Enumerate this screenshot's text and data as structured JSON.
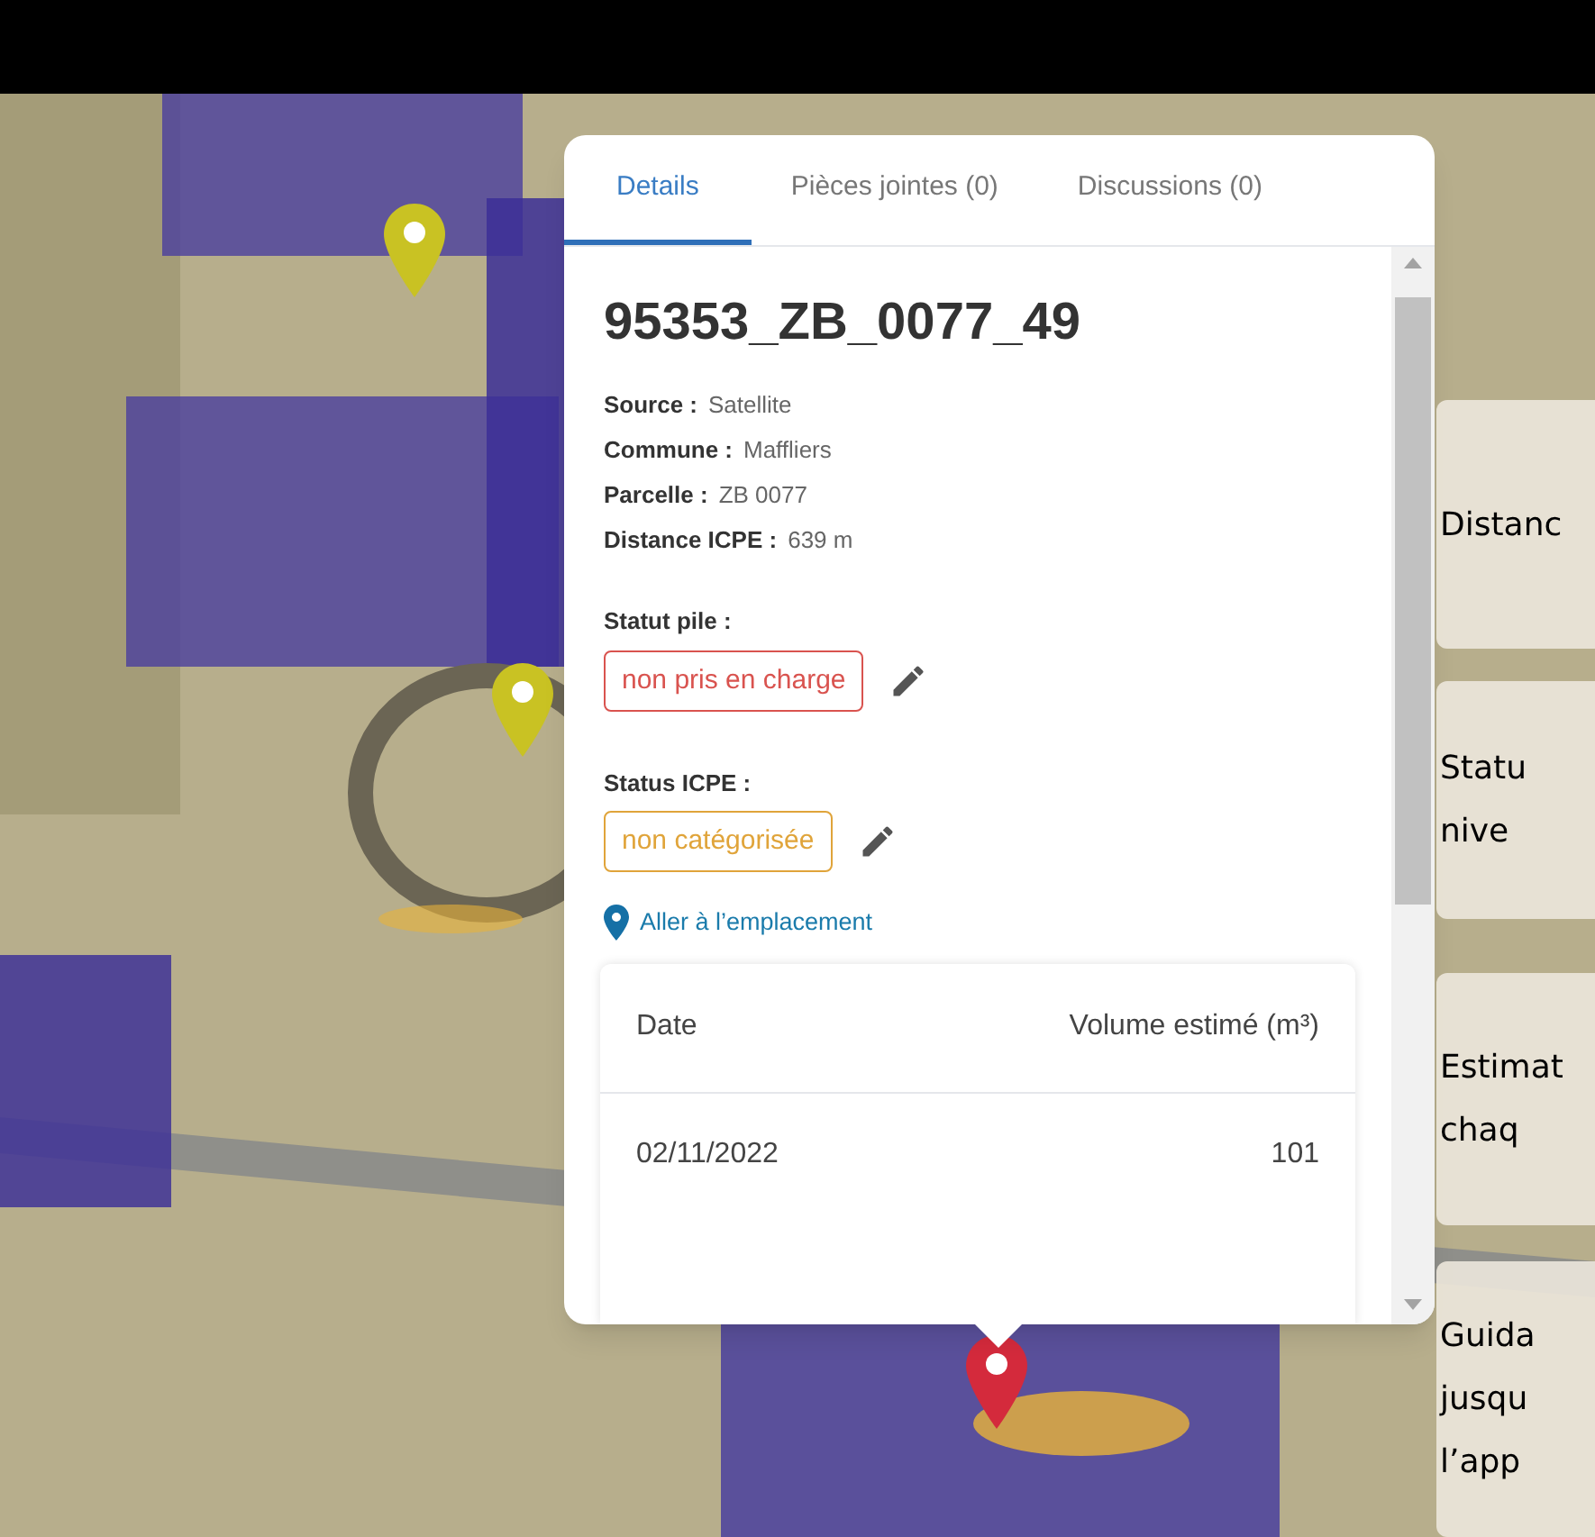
{
  "tabs": [
    {
      "label": "Details",
      "selected": true
    },
    {
      "label": "Pièces jointes (0)",
      "selected": false
    },
    {
      "label": "Discussions (0)",
      "selected": false
    }
  ],
  "title": "95353_ZB_0077_49",
  "fields": [
    {
      "label": "Source :",
      "value": "Satellite"
    },
    {
      "label": "Commune :",
      "value": "Maffliers"
    },
    {
      "label": "Parcelle :",
      "value": "ZB 0077"
    },
    {
      "label": "Distance ICPE :",
      "value": "639 m"
    }
  ],
  "statuses": [
    {
      "label": "Statut pile :",
      "value": "non pris en charge",
      "color": "#d9534f"
    },
    {
      "label": "Status ICPE :",
      "value": "non catégorisée",
      "color": "#e0a43a"
    }
  ],
  "location_link": "Aller à l’emplacement",
  "table": {
    "columns": [
      "Date",
      "Volume estimé (m³)"
    ],
    "rows": [
      [
        "02/11/2022",
        "101"
      ]
    ]
  },
  "markers": [
    {
      "color": "#c9c223"
    },
    {
      "color": "#c9c223"
    },
    {
      "color": "#d42a3c"
    }
  ],
  "callouts": [
    {
      "lines": [
        "Distanc"
      ]
    },
    {
      "lines": [
        "Statu",
        "nive"
      ]
    },
    {
      "lines": [
        "Estimat",
        "chaq"
      ]
    },
    {
      "lines": [
        "Guida",
        "jusqu",
        "l’app"
      ]
    }
  ]
}
